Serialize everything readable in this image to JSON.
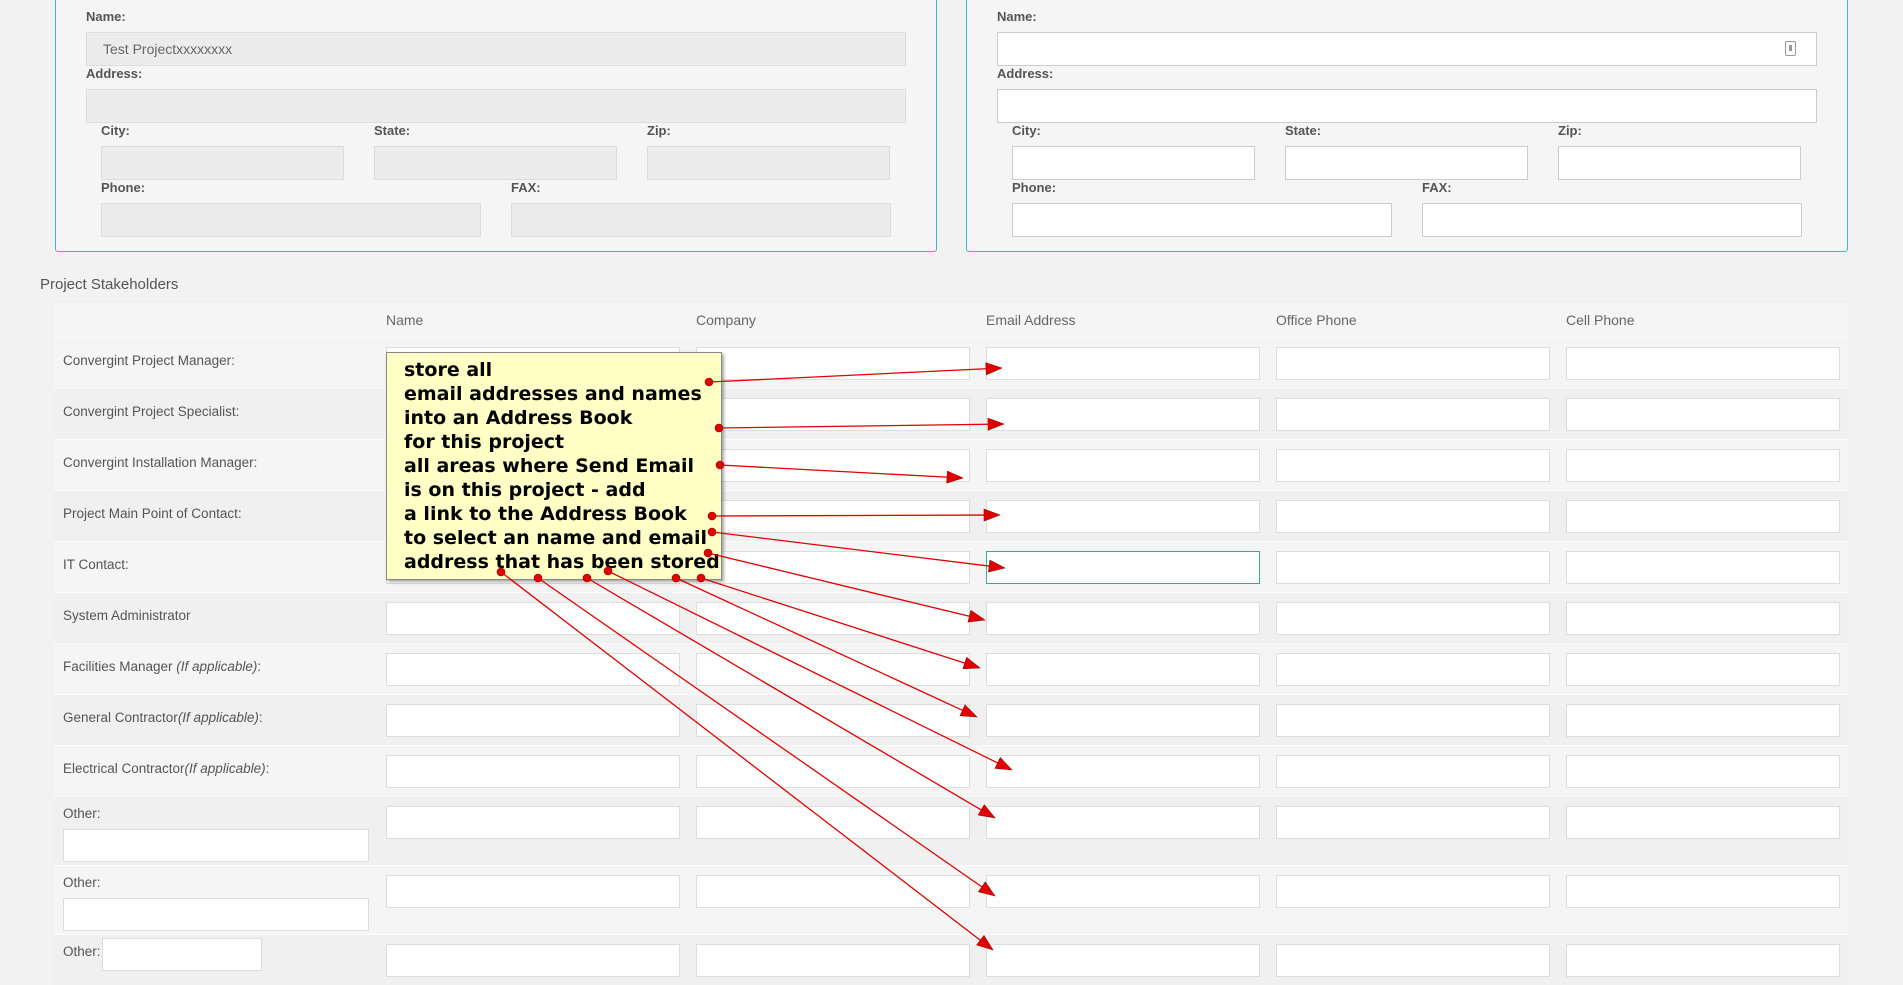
{
  "left_panel": {
    "name_label": "Name:",
    "name_value": "Test Projectxxxxxxxx",
    "address_label": "Address:",
    "city_label": "City:",
    "state_label": "State:",
    "zip_label": "Zip:",
    "phone_label": "Phone:",
    "fax_label": "FAX:"
  },
  "right_panel": {
    "name_label": "Name:",
    "name_icon": "address-card-icon",
    "address_label": "Address:",
    "city_label": "City:",
    "state_label": "State:",
    "zip_label": "Zip:",
    "phone_label": "Phone:",
    "fax_label": "FAX:"
  },
  "stakeholders": {
    "title": "Project Stakeholders",
    "columns": [
      "Name",
      "Company",
      "Email Address",
      "Office Phone",
      "Cell Phone"
    ],
    "rows": [
      {
        "label": "Convergint Project Manager:",
        "note": ""
      },
      {
        "label": "Convergint Project Specialist:",
        "note": ""
      },
      {
        "label": "Convergint Installation Manager:",
        "note": ""
      },
      {
        "label": "Project Main Point of Contact:",
        "note": ""
      },
      {
        "label": "IT Contact:",
        "note": ""
      },
      {
        "label": "System Administrator",
        "note": ""
      },
      {
        "label": "Facilities Manager ",
        "note": "(If applicable)",
        "suffix": ":"
      },
      {
        "label": "General Contractor",
        "note": "(If applicable)",
        "suffix": ":"
      },
      {
        "label": "Electrical Contractor",
        "note": "(If applicable)",
        "suffix": ":"
      },
      {
        "label": "Other:",
        "note": ""
      },
      {
        "label": "Other:",
        "note": ""
      },
      {
        "label": "Other:",
        "note": ""
      }
    ]
  },
  "annotation": {
    "lines": [
      "store all",
      "email addresses and names",
      "into an Address Book",
      "for this project",
      "all areas where Send Email",
      "is on this project - add",
      "a link to the Address Book",
      "to select an name and email",
      "address that has been stored"
    ],
    "arrow_color": "#e00000",
    "callout_bg": "#ffffc6"
  }
}
